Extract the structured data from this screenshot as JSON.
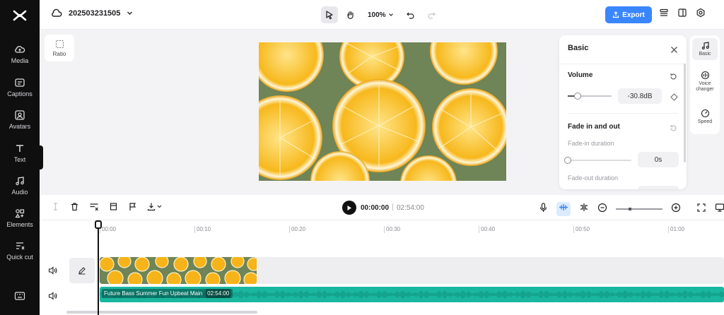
{
  "sidebar": {
    "items": [
      {
        "label": "Media",
        "icon": "cloud-upload-icon"
      },
      {
        "label": "Captions",
        "icon": "captions-icon"
      },
      {
        "label": "Avatars",
        "icon": "avatar-icon"
      },
      {
        "label": "Text",
        "icon": "text-icon"
      },
      {
        "label": "Audio",
        "icon": "music-note-icon"
      },
      {
        "label": "Elements",
        "icon": "elements-icon"
      },
      {
        "label": "Quick cut",
        "icon": "quick-cut-icon"
      }
    ]
  },
  "header": {
    "project_name": "202503231505",
    "zoom": "100%",
    "export_label": "Export"
  },
  "canvas": {
    "ratio_label": "Ratio"
  },
  "basic_panel": {
    "title": "Basic",
    "volume": {
      "title": "Volume",
      "value_text": "-30.8dB",
      "level": 0.22
    },
    "fade": {
      "title": "Fade in and out",
      "fade_in_label": "Fade-in duration",
      "fade_in_value": "0s",
      "fade_in_level": 0,
      "fade_out_label": "Fade-out duration"
    }
  },
  "right_rail": {
    "items": [
      {
        "label": "Basic",
        "icon": "music-note-icon",
        "active": true
      },
      {
        "label": "Voice changer",
        "icon": "voice-changer-icon",
        "active": false
      },
      {
        "label": "Speed",
        "icon": "speed-icon",
        "active": false
      }
    ]
  },
  "timeline": {
    "current_time": "00:00:00",
    "separator": "|",
    "total_time": "02:54:00",
    "ruler": [
      "00:00",
      "00:10",
      "00:20",
      "00:30",
      "00:40",
      "00:50",
      "01:00"
    ],
    "audio_clip": {
      "title": "Future Bass Summer Fun Upbeat Main",
      "duration": "02:54:00"
    }
  },
  "colors": {
    "accent": "#3a86ff",
    "audio_track": "#1ab7a0",
    "sidebar_bg": "#0f0f10"
  }
}
